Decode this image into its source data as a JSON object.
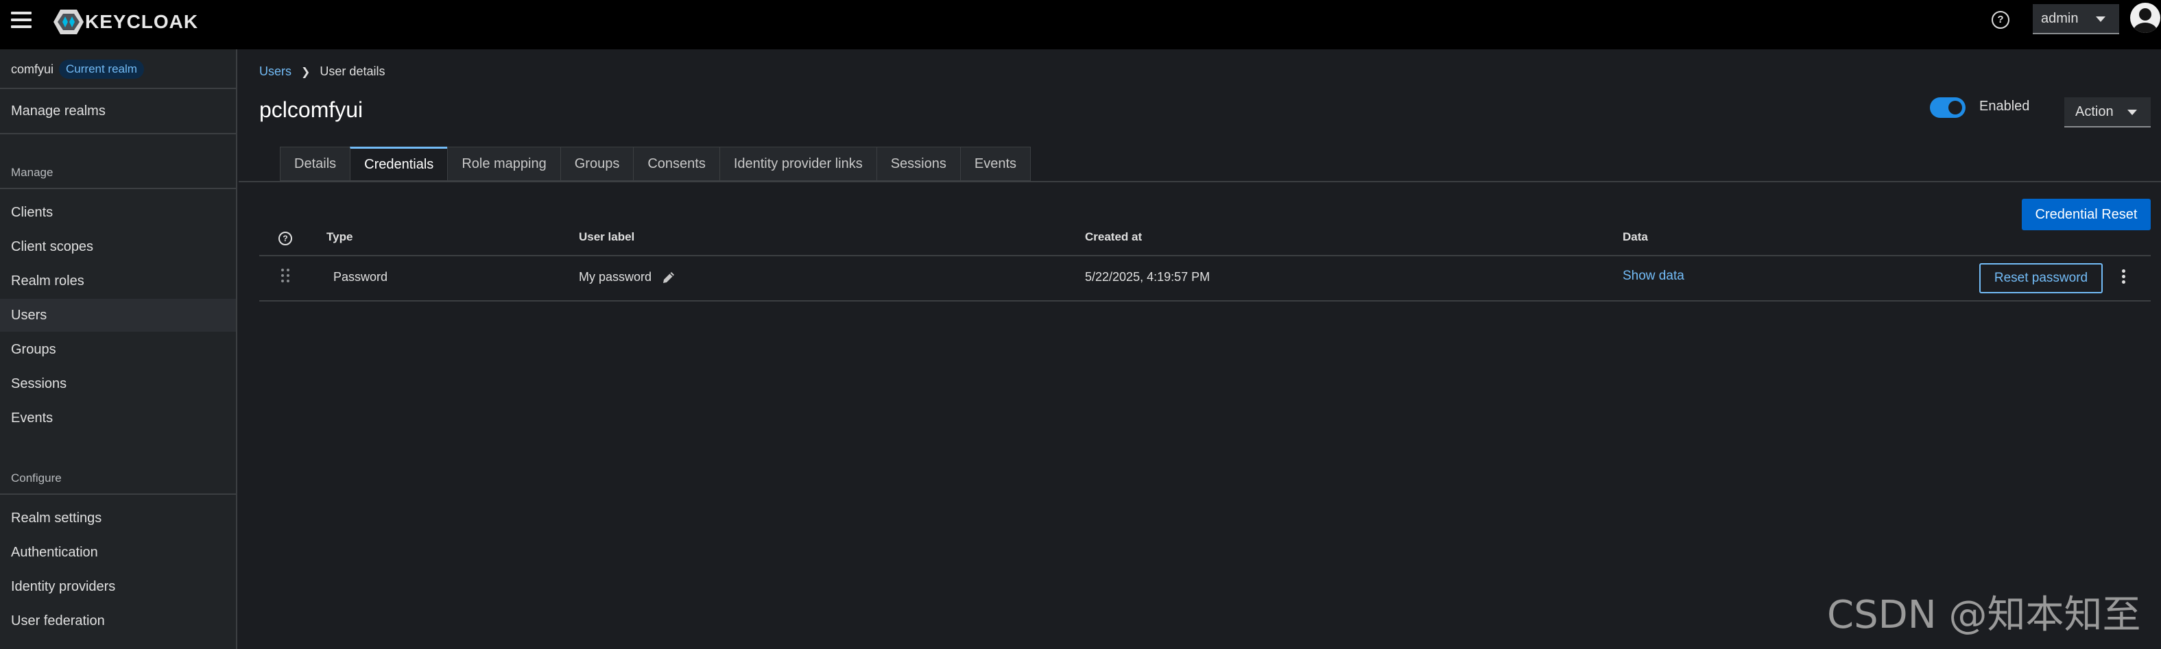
{
  "masthead": {
    "logo_text": "KEYCLOAK",
    "user_menu": "admin"
  },
  "sidebar": {
    "realm_name": "comfyui",
    "realm_badge": "Current realm",
    "manage_realms": "Manage realms",
    "section_manage": "Manage",
    "manage_items": [
      {
        "label": "Clients"
      },
      {
        "label": "Client scopes"
      },
      {
        "label": "Realm roles"
      },
      {
        "label": "Users"
      },
      {
        "label": "Groups"
      },
      {
        "label": "Sessions"
      },
      {
        "label": "Events"
      }
    ],
    "section_configure": "Configure",
    "configure_items": [
      {
        "label": "Realm settings"
      },
      {
        "label": "Authentication"
      },
      {
        "label": "Identity providers"
      },
      {
        "label": "User federation"
      }
    ],
    "active_item": "Users"
  },
  "breadcrumb": {
    "parent": "Users",
    "current": "User details"
  },
  "page": {
    "title": "pclcomfyui",
    "enabled_label": "Enabled",
    "enabled": true,
    "action_label": "Action"
  },
  "tabs": [
    {
      "label": "Details"
    },
    {
      "label": "Credentials"
    },
    {
      "label": "Role mapping"
    },
    {
      "label": "Groups"
    },
    {
      "label": "Consents"
    },
    {
      "label": "Identity provider links"
    },
    {
      "label": "Sessions"
    },
    {
      "label": "Events"
    }
  ],
  "active_tab": "Credentials",
  "credential_reset_label": "Credential Reset",
  "table": {
    "headers": {
      "type": "Type",
      "user_label": "User label",
      "created_at": "Created at",
      "data": "Data"
    },
    "rows": [
      {
        "type": "Password",
        "user_label": "My password",
        "created_at": "5/22/2025, 4:19:57 PM",
        "data_link": "Show data",
        "reset_button": "Reset password"
      }
    ]
  },
  "watermark": "CSDN @知本知至",
  "colors": {
    "accent": "#73bcf7",
    "primary_button": "#0066cc",
    "masthead": "#000000",
    "background": "#1b1d21"
  }
}
